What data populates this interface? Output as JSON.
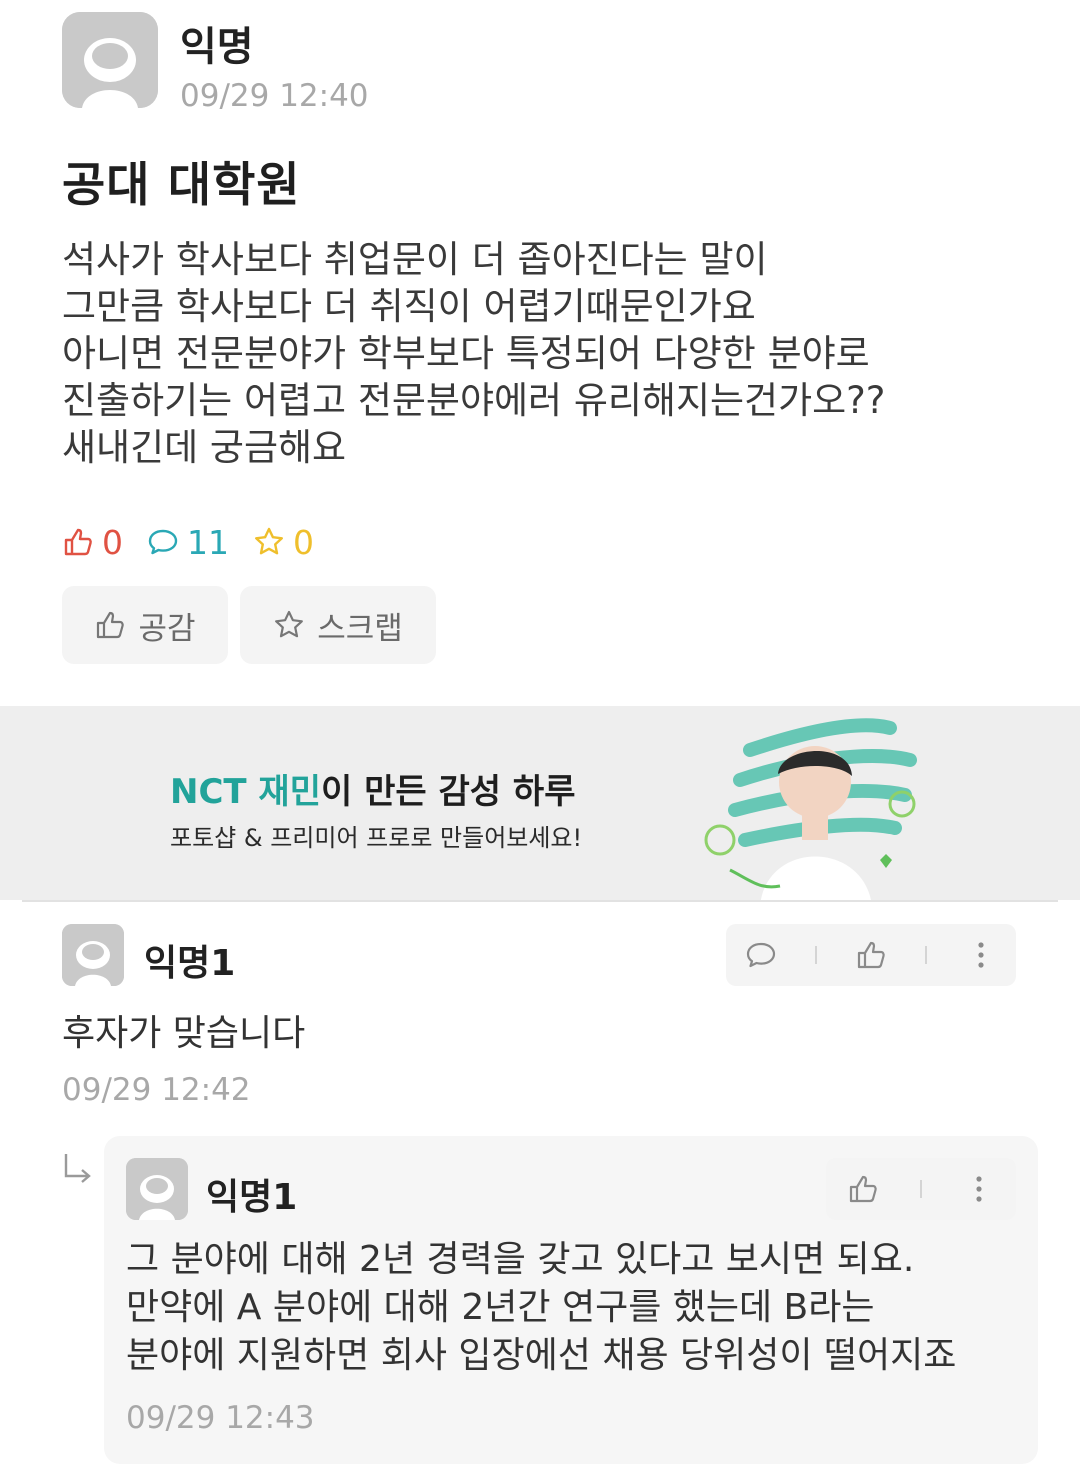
{
  "post": {
    "author": "익명",
    "time": "09/29 12:40",
    "title": "공대 대학원",
    "body_lines": [
      "석사가 학사보다 취업문이 더 좁아진다는 말이",
      "그만큼 학사보다 더 취직이 어렵기때문인가요",
      "아니면 전문분야가 학부보다 특정되어 다양한 분야로",
      "진출하기는 어렵고 전문분야에러 유리해지는건가오??",
      "새내긴데 궁금해요"
    ],
    "stats": {
      "likes": "0",
      "comments": "11",
      "scraps": "0"
    },
    "buttons": {
      "like_label": "공감",
      "scrap_label": "스크랩"
    }
  },
  "ad": {
    "headline_highlight": "NCT 재민",
    "headline_rest": "이 만든 감성 하루",
    "subline": "포토샵 & 프리미어 프로로 만들어보세요!"
  },
  "comments": [
    {
      "author": "익명1",
      "text": "후자가 맞습니다",
      "time": "09/29 12:42",
      "replies": [
        {
          "author": "익명1",
          "lines": [
            "그 분야에 대해 2년 경력을 갖고 있다고 보시면 되요.",
            "만약에 A 분야에 대해 2년간 연구를 했는데 B라는",
            "분야에 지원하면 회사 입장에선 채용 당위성이 떨어지죠"
          ],
          "time": "09/29 12:43"
        }
      ]
    }
  ],
  "colors": {
    "like": "#e05243",
    "comment": "#2aa8b5",
    "scrap": "#efbf2c",
    "ad_highlight": "#22a39a"
  },
  "icons": [
    "avatar-icon",
    "thumbs-up-icon",
    "speech-bubble-icon",
    "star-icon",
    "more-vertical-icon",
    "reply-arrow-icon"
  ]
}
